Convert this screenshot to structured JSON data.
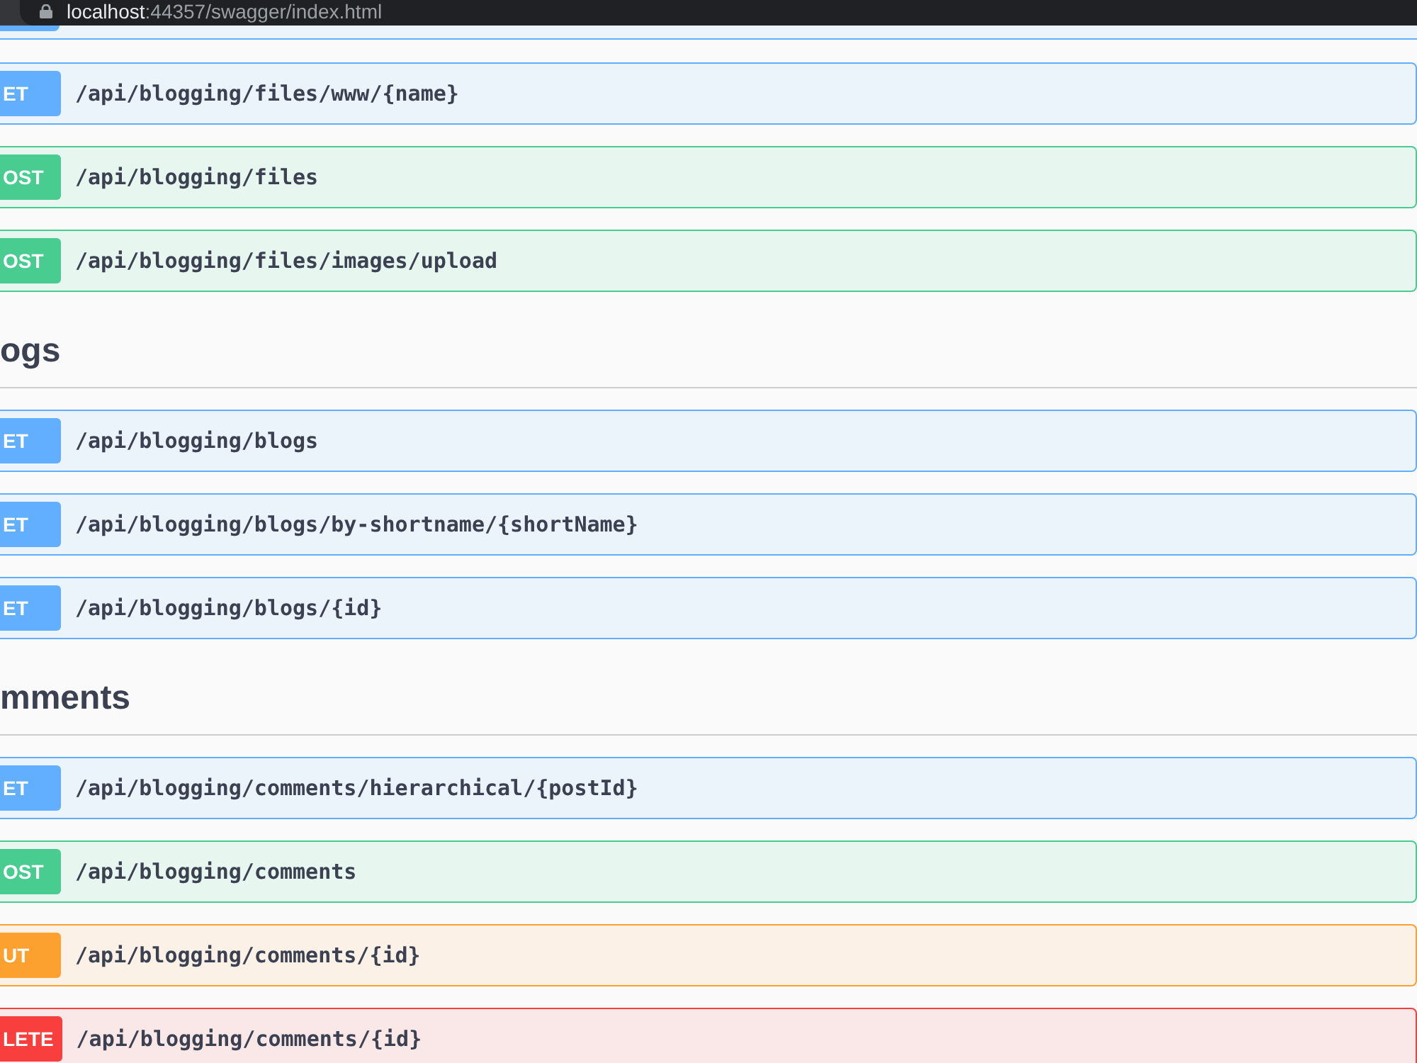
{
  "address_bar": {
    "host": "localhost",
    "rest": ":44357/swagger/index.html"
  },
  "top_cut_row": {
    "kind": "get"
  },
  "sections": [
    {
      "operations": [
        {
          "kind": "get",
          "badge": "ET",
          "path": "/api/blogging/files/www/{name}"
        },
        {
          "kind": "post",
          "badge": "OST",
          "path": "/api/blogging/files"
        },
        {
          "kind": "post",
          "badge": "OST",
          "path": "/api/blogging/files/images/upload"
        }
      ]
    },
    {
      "title": "ogs",
      "operations": [
        {
          "kind": "get",
          "badge": "ET",
          "path": "/api/blogging/blogs"
        },
        {
          "kind": "get",
          "badge": "ET",
          "path": "/api/blogging/blogs/by-shortname/{shortName}"
        },
        {
          "kind": "get",
          "badge": "ET",
          "path": "/api/blogging/blogs/{id}"
        }
      ]
    },
    {
      "title": "mments",
      "operations": [
        {
          "kind": "get",
          "badge": "ET",
          "path": "/api/blogging/comments/hierarchical/{postId}"
        },
        {
          "kind": "post",
          "badge": "OST",
          "path": "/api/blogging/comments"
        },
        {
          "kind": "put",
          "badge": "UT",
          "path": "/api/blogging/comments/{id}"
        },
        {
          "kind": "delete",
          "badge": "LETE",
          "path": "/api/blogging/comments/{id}"
        }
      ]
    }
  ]
}
